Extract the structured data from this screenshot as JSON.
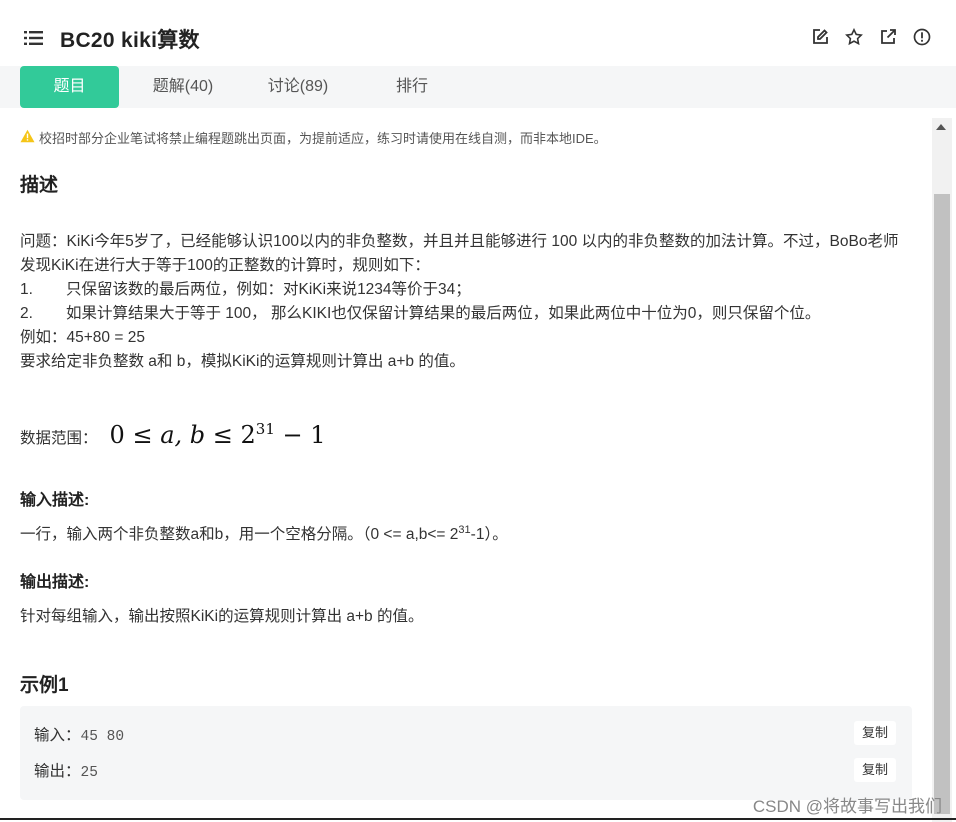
{
  "header": {
    "title": "BC20  kiki算数",
    "icons": [
      "list-icon",
      "edit-icon",
      "star-icon",
      "external-link-icon",
      "info-icon"
    ]
  },
  "tabs": [
    {
      "label": "题目",
      "active": true
    },
    {
      "label": "题解(40)",
      "active": false
    },
    {
      "label": "讨论(89)",
      "active": false
    },
    {
      "label": "排行",
      "active": false
    }
  ],
  "notice": "校招时部分企业笔试将禁止编程题跳出页面，为提前适应，练习时请使用在线自测，而非本地IDE。",
  "description": {
    "heading": "描述",
    "line1": "问题：KiKi今年5岁了，已经能够认识100以内的非负整数，并且并且能够进行 100 以内的非负整数的加法计算。不过，BoBo老师发现KiKi在进行大于等于100的正整数的计算时，规则如下：",
    "item1_num": "1.",
    "item1_text": "只保留该数的最后两位，例如：对KiKi来说1234等价于34；",
    "item2_num": "2.",
    "item2_text": "如果计算结果大于等于 100， 那么KIKI也仅保留计算结果的最后两位，如果此两位中十位为0，则只保留个位。",
    "example_line": "例如：45+80 = 25",
    "task_line": "要求给定非负整数 a和 b，模拟KiKi的运算规则计算出 a+b 的值。",
    "range_label": "数据范围：",
    "range_math": {
      "lhs": "0",
      "le1": "≤",
      "vars": "a, b",
      "le2": "≤",
      "base": "2",
      "exp": "31",
      "minus": "−",
      "one": "1"
    }
  },
  "input_desc": {
    "heading": "输入描述:",
    "text_before": "一行，输入两个非负整数a和b，用一个空格分隔。（0 <= a,b<= 2",
    "sup": "31",
    "text_after": "-1）。"
  },
  "output_desc": {
    "heading": "输出描述:",
    "text": "针对每组输入，输出按照KiKi的运算规则计算出 a+b 的值。"
  },
  "example1": {
    "heading": "示例1",
    "input_label": "输入：",
    "input_value": "45 80",
    "output_label": "输出：",
    "output_value": "25",
    "copy_label": "复制"
  },
  "watermark": "CSDN @将故事写出我们",
  "colors": {
    "accent": "#32ca99",
    "warning": "#f5c518"
  }
}
